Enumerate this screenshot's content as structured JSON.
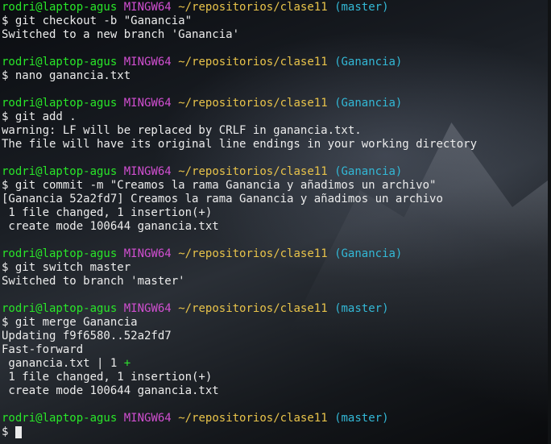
{
  "prompt": {
    "user": "rodri@laptop-agus",
    "env": "MINGW64",
    "path": "~/repositorios/clase11"
  },
  "blocks": [
    {
      "branch": "(master)",
      "cmd": "$ git checkout -b \"Ganancia\"",
      "output": [
        "Switched to a new branch 'Ganancia'"
      ]
    },
    {
      "branch": "(Ganancia)",
      "cmd": "$ nano ganancia.txt",
      "output": []
    },
    {
      "branch": "(Ganancia)",
      "cmd": "$ git add .",
      "output": [
        "warning: LF will be replaced by CRLF in ganancia.txt.",
        "The file will have its original line endings in your working directory"
      ]
    },
    {
      "branch": "(Ganancia)",
      "cmd": "$ git commit -m \"Creamos la rama Ganancia y añadimos un archivo\"",
      "output": [
        "[Ganancia 52a2fd7] Creamos la rama Ganancia y añadimos un archivo",
        " 1 file changed, 1 insertion(+)",
        " create mode 100644 ganancia.txt"
      ]
    },
    {
      "branch": "(Ganancia)",
      "cmd": "$ git switch master",
      "output": [
        "Switched to branch 'master'"
      ]
    },
    {
      "branch": "(master)",
      "cmd": "$ git merge Ganancia",
      "output": [
        "Updating f9f6580..52a2fd7",
        "Fast-forward"
      ]
    }
  ],
  "diffstat": {
    "text": " ganancia.txt | 1 ",
    "plus": "+"
  },
  "merge_tail": [
    " 1 file changed, 1 insertion(+)",
    " create mode 100644 ganancia.txt"
  ],
  "final": {
    "branch": "(master)",
    "cmd": "$ "
  }
}
